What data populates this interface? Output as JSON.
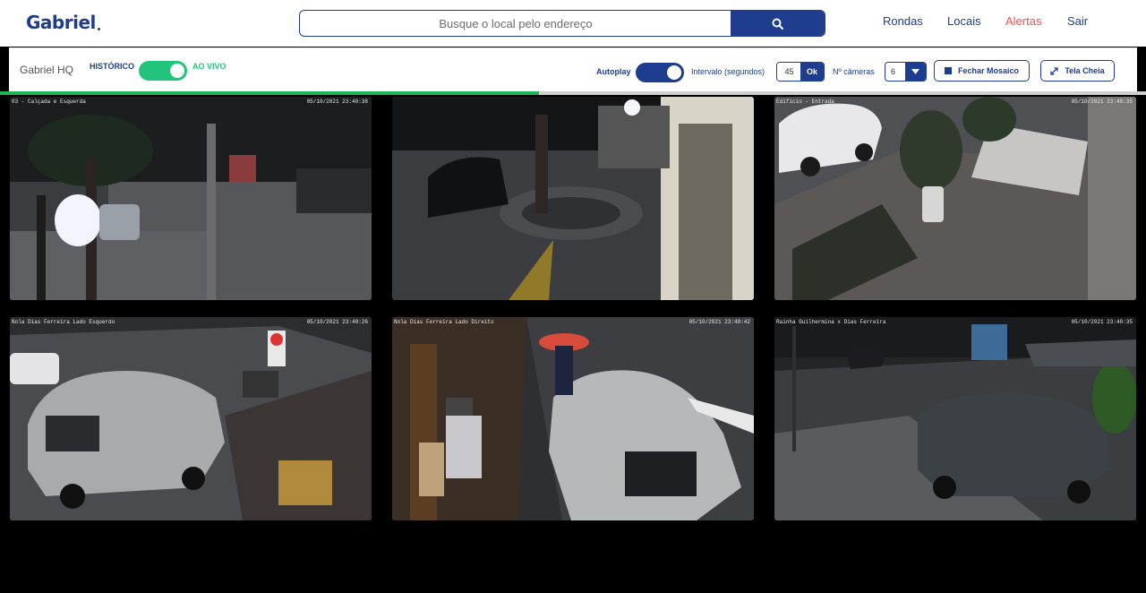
{
  "app": {
    "brand": "Gabriel",
    "brand_color": "#1f3d8f",
    "accent_live": "#20c47a",
    "alert_color": "#e8554b"
  },
  "search": {
    "placeholder": "Busque o local pelo endereço",
    "icon": "search-icon"
  },
  "nav": {
    "rondas": "Rondas",
    "locais": "Locais",
    "alertas": "Alertas",
    "sair": "Sair"
  },
  "controls": {
    "location_name": "Gabriel HQ",
    "historico_label": "HISTÓRICO",
    "live_label": "AO VIVO",
    "live_enabled": true,
    "autoplay_label": "Autoplay",
    "autoplay_enabled": true,
    "interval_label": "Intervalo (segundos)",
    "interval_value": "45",
    "ok_label": "Ok",
    "cameras_label": "Nº câmeras",
    "cameras_value": "6",
    "close_mosaic_label": "Fechar Mosaico",
    "fullscreen_label": "Tela Cheia",
    "autoplay_progress": 0.47
  },
  "cameras": [
    {
      "title": "03 - Calçada e Esquerda",
      "timestamp": "05/10/2021 23:40:38"
    },
    {
      "title": "",
      "timestamp": ""
    },
    {
      "title": "Edifício - Entrada",
      "timestamp": "05/10/2021 23:40:35"
    },
    {
      "title": "Nola Dias Ferreira Lado Esquerdo",
      "timestamp": "05/10/2021 23:40:26"
    },
    {
      "title": "Nola Dias Ferreira Lado Direito",
      "timestamp": "05/10/2021 23:40:42"
    },
    {
      "title": "Rainha Guilhermina x Dias Ferreira",
      "timestamp": "05/10/2021 23:40:35"
    }
  ]
}
